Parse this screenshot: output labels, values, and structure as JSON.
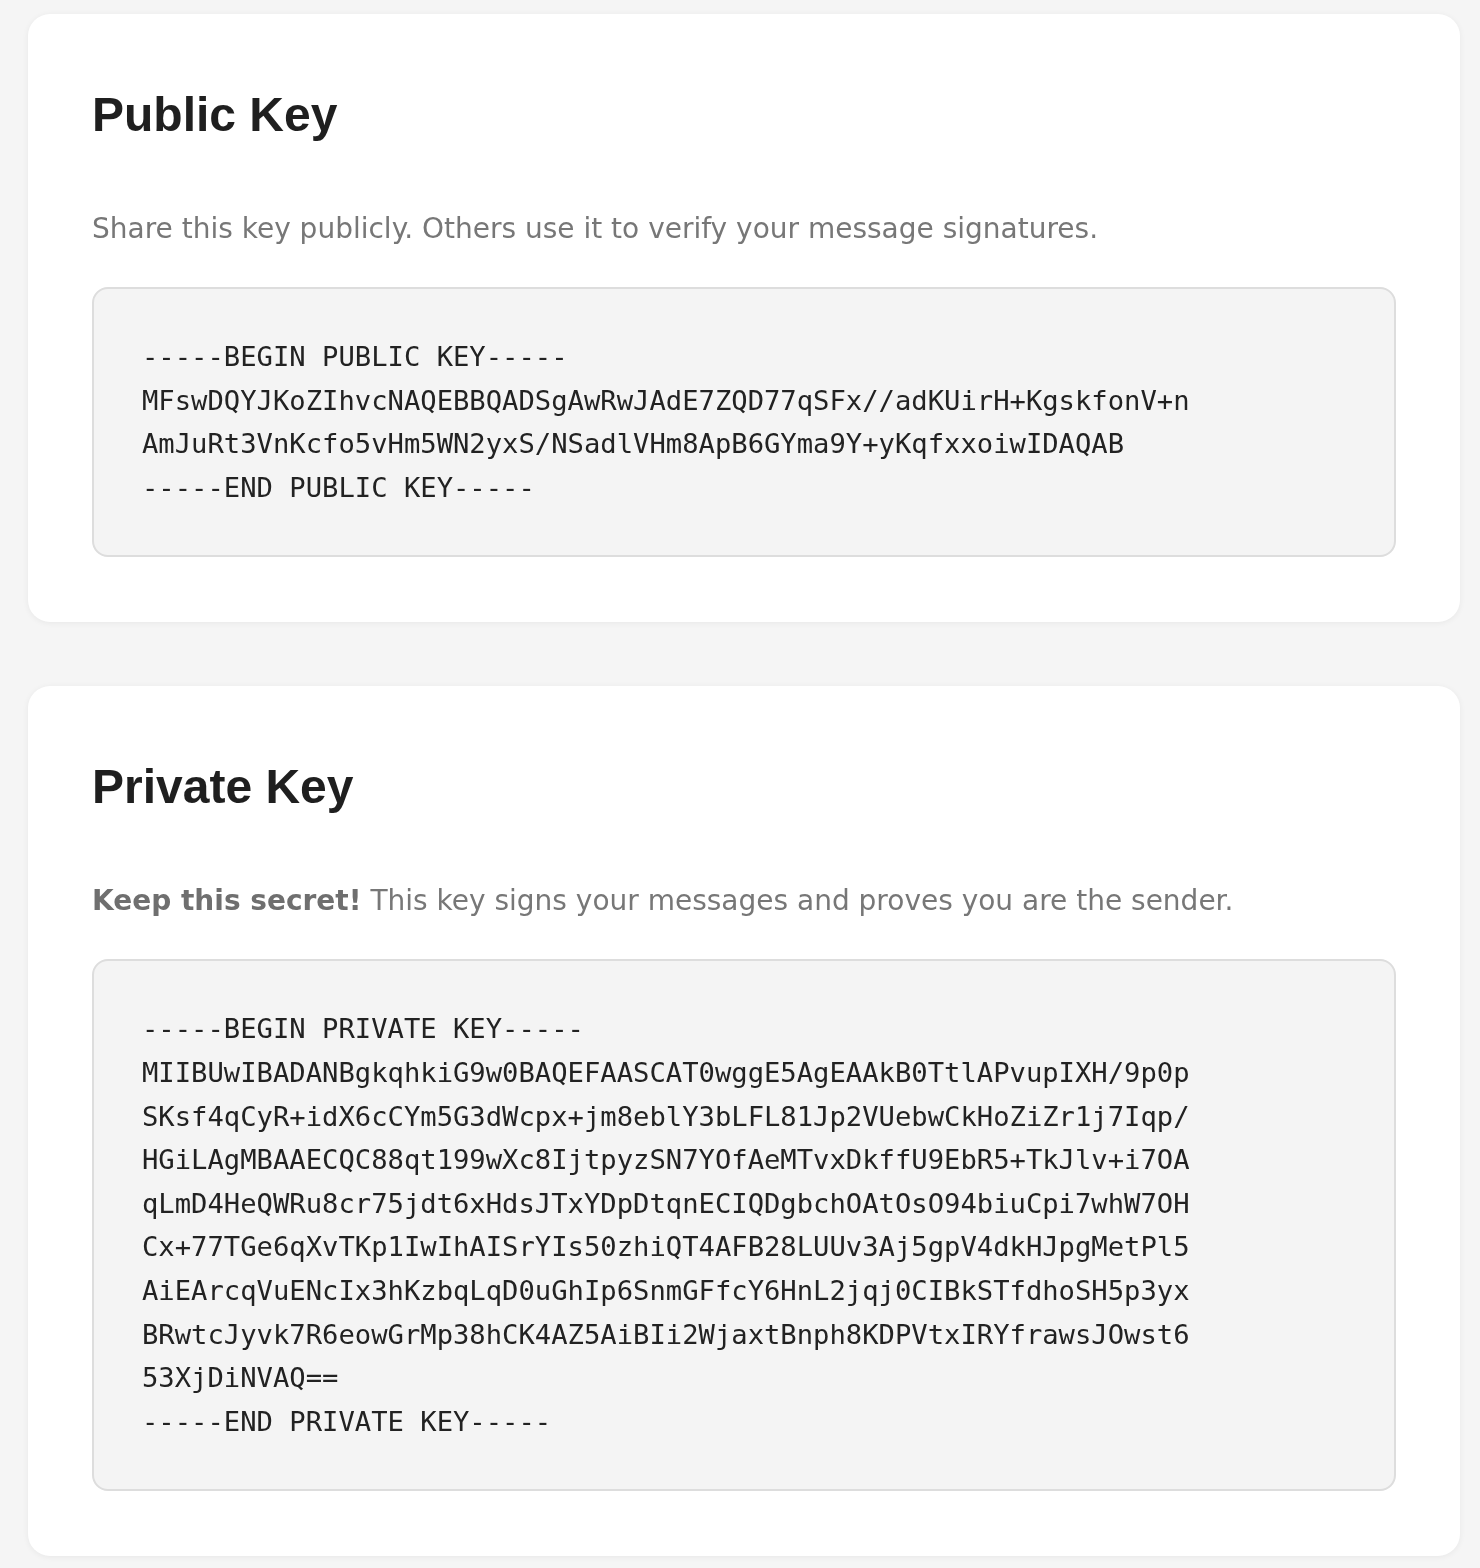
{
  "cards": [
    {
      "title": "Public Key",
      "description": "Share this key publicly. Others use it to verify your message signatures.",
      "key_lines": [
        "-----BEGIN PUBLIC KEY-----",
        "MFswDQYJKoZIhvcNAQEBBQADSgAwRwJAdE7ZQD77qSFx//adKUirH+KgskfonV+n",
        "AmJuRt3VnKcfo5vHm5WN2yxS/NSadlVHm8ApB6GYma9Y+yKqfxxoiwIDAQAB",
        "-----END PUBLIC KEY-----"
      ]
    },
    {
      "title": "Private Key",
      "description": "**Keep this secret!** This key signs your messages and proves you are the sender.",
      "key_lines": [
        "-----BEGIN PRIVATE KEY-----",
        "MIIBUwIBADANBgkqhkiG9w0BAQEFAASCAT0wggE5AgEAAkB0TtlAPvupIXH/9p0p",
        "SKsf4qCyR+idX6cCYm5G3dWcpx+jm8eblY3bLFL81Jp2VUebwCkHoZiZr1j7Iqp/",
        "HGiLAgMBAAECQC88qt199wXc8IjtpyzSN7YOfAeMTvxDkffU9EbR5+TkJlv+i7OA",
        "qLmD4HeQWRu8cr75jdt6xHdsJTxYDpDtqnECIQDgbchOAtOsO94biuCpi7whW7OH",
        "Cx+77TGe6qXvTKp1IwIhAISrYIs50zhiQT4AFB28LUUv3Aj5gpV4dkHJpgMetPl5",
        "AiEArcqVuENcIx3hKzbqLqD0uGhIp6SnmGFfcY6HnL2jqj0CIBkSTfdhoSH5p3yx",
        "BRwtcJyvk7R6eowGrMp38hCK4AZ5AiBIi2WjaxtBnph8KDPVtxIRYfrawsJOwst6",
        "53XjDiNVAQ==",
        "-----END PRIVATE KEY-----"
      ]
    }
  ]
}
